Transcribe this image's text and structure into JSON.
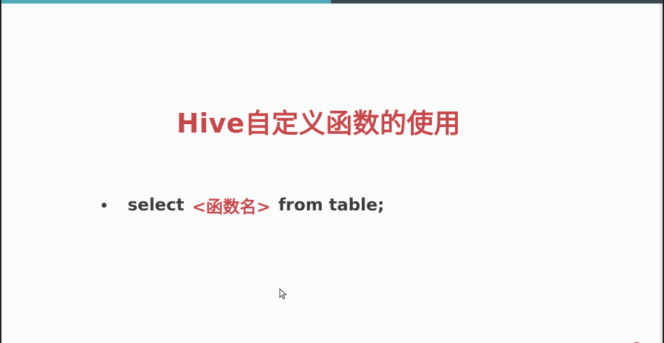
{
  "slide": {
    "title": "Hive自定义函数的使用",
    "bullet": {
      "prefix": "select",
      "function_placeholder": "<函数名>",
      "suffix": "from table;"
    }
  },
  "colors": {
    "accent_red": "#c8474b",
    "body_text": "#3c3c3c",
    "top_bar_teal": "#4aa9b5",
    "top_bar_dark": "#3a4a4d",
    "slide_background": "#fafcfb"
  },
  "icons": {
    "cursor": "mouse-pointer-icon"
  }
}
